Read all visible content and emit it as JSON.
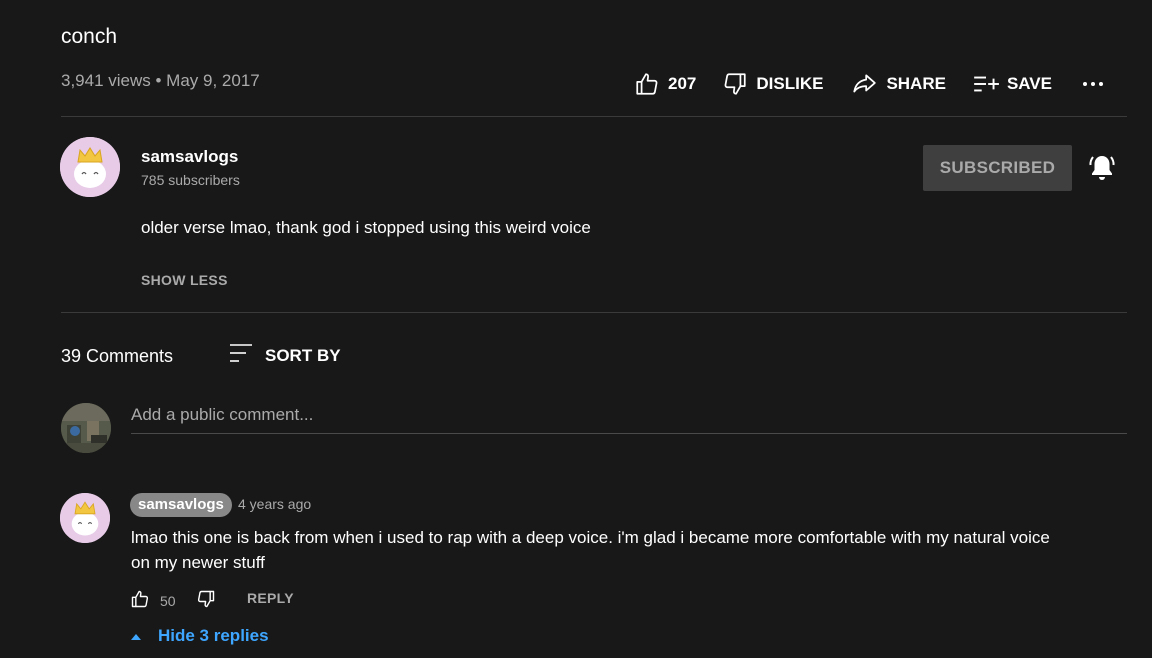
{
  "video": {
    "title": "conch",
    "meta": "3,941 views • May 9, 2017",
    "like_count": "207",
    "dislike_label": "DISLIKE",
    "share_label": "SHARE",
    "save_label": "SAVE",
    "more_label": "•••"
  },
  "channel": {
    "name": "samsavlogs",
    "subscribers": "785 subscribers",
    "subscribe_state": "SUBSCRIBED",
    "description": "older verse lmao, thank god i stopped using this weird voice",
    "show_less_label": "SHOW LESS"
  },
  "comments": {
    "count_label": "39 Comments",
    "sort_label": "SORT BY",
    "add_placeholder": "Add a public comment...",
    "items": [
      {
        "author": "samsavlogs",
        "time": "4 years ago",
        "text": "lmao this one is back from when i used to rap with a deep voice. i'm glad i became more comfortable with my natural voice on my newer stuff",
        "likes": "50",
        "reply_label": "REPLY",
        "hide_replies_label": "Hide 3 replies"
      }
    ]
  },
  "icons": {
    "like": "thumb-up-icon",
    "dislike": "thumb-down-icon",
    "share": "share-arrow-icon",
    "save": "playlist-add-icon",
    "more": "more-horizontal-icon",
    "bell": "notification-bell-icon",
    "sort": "sort-lines-icon",
    "caret": "caret-up-icon"
  },
  "colors": {
    "background": "#181818",
    "text_primary": "#ffffff",
    "text_secondary": "#aaaaaa",
    "link_blue": "#3ea6ff",
    "avatar_bg": "#e7cbe7",
    "subscribed_btn": "#3f3f3f"
  }
}
